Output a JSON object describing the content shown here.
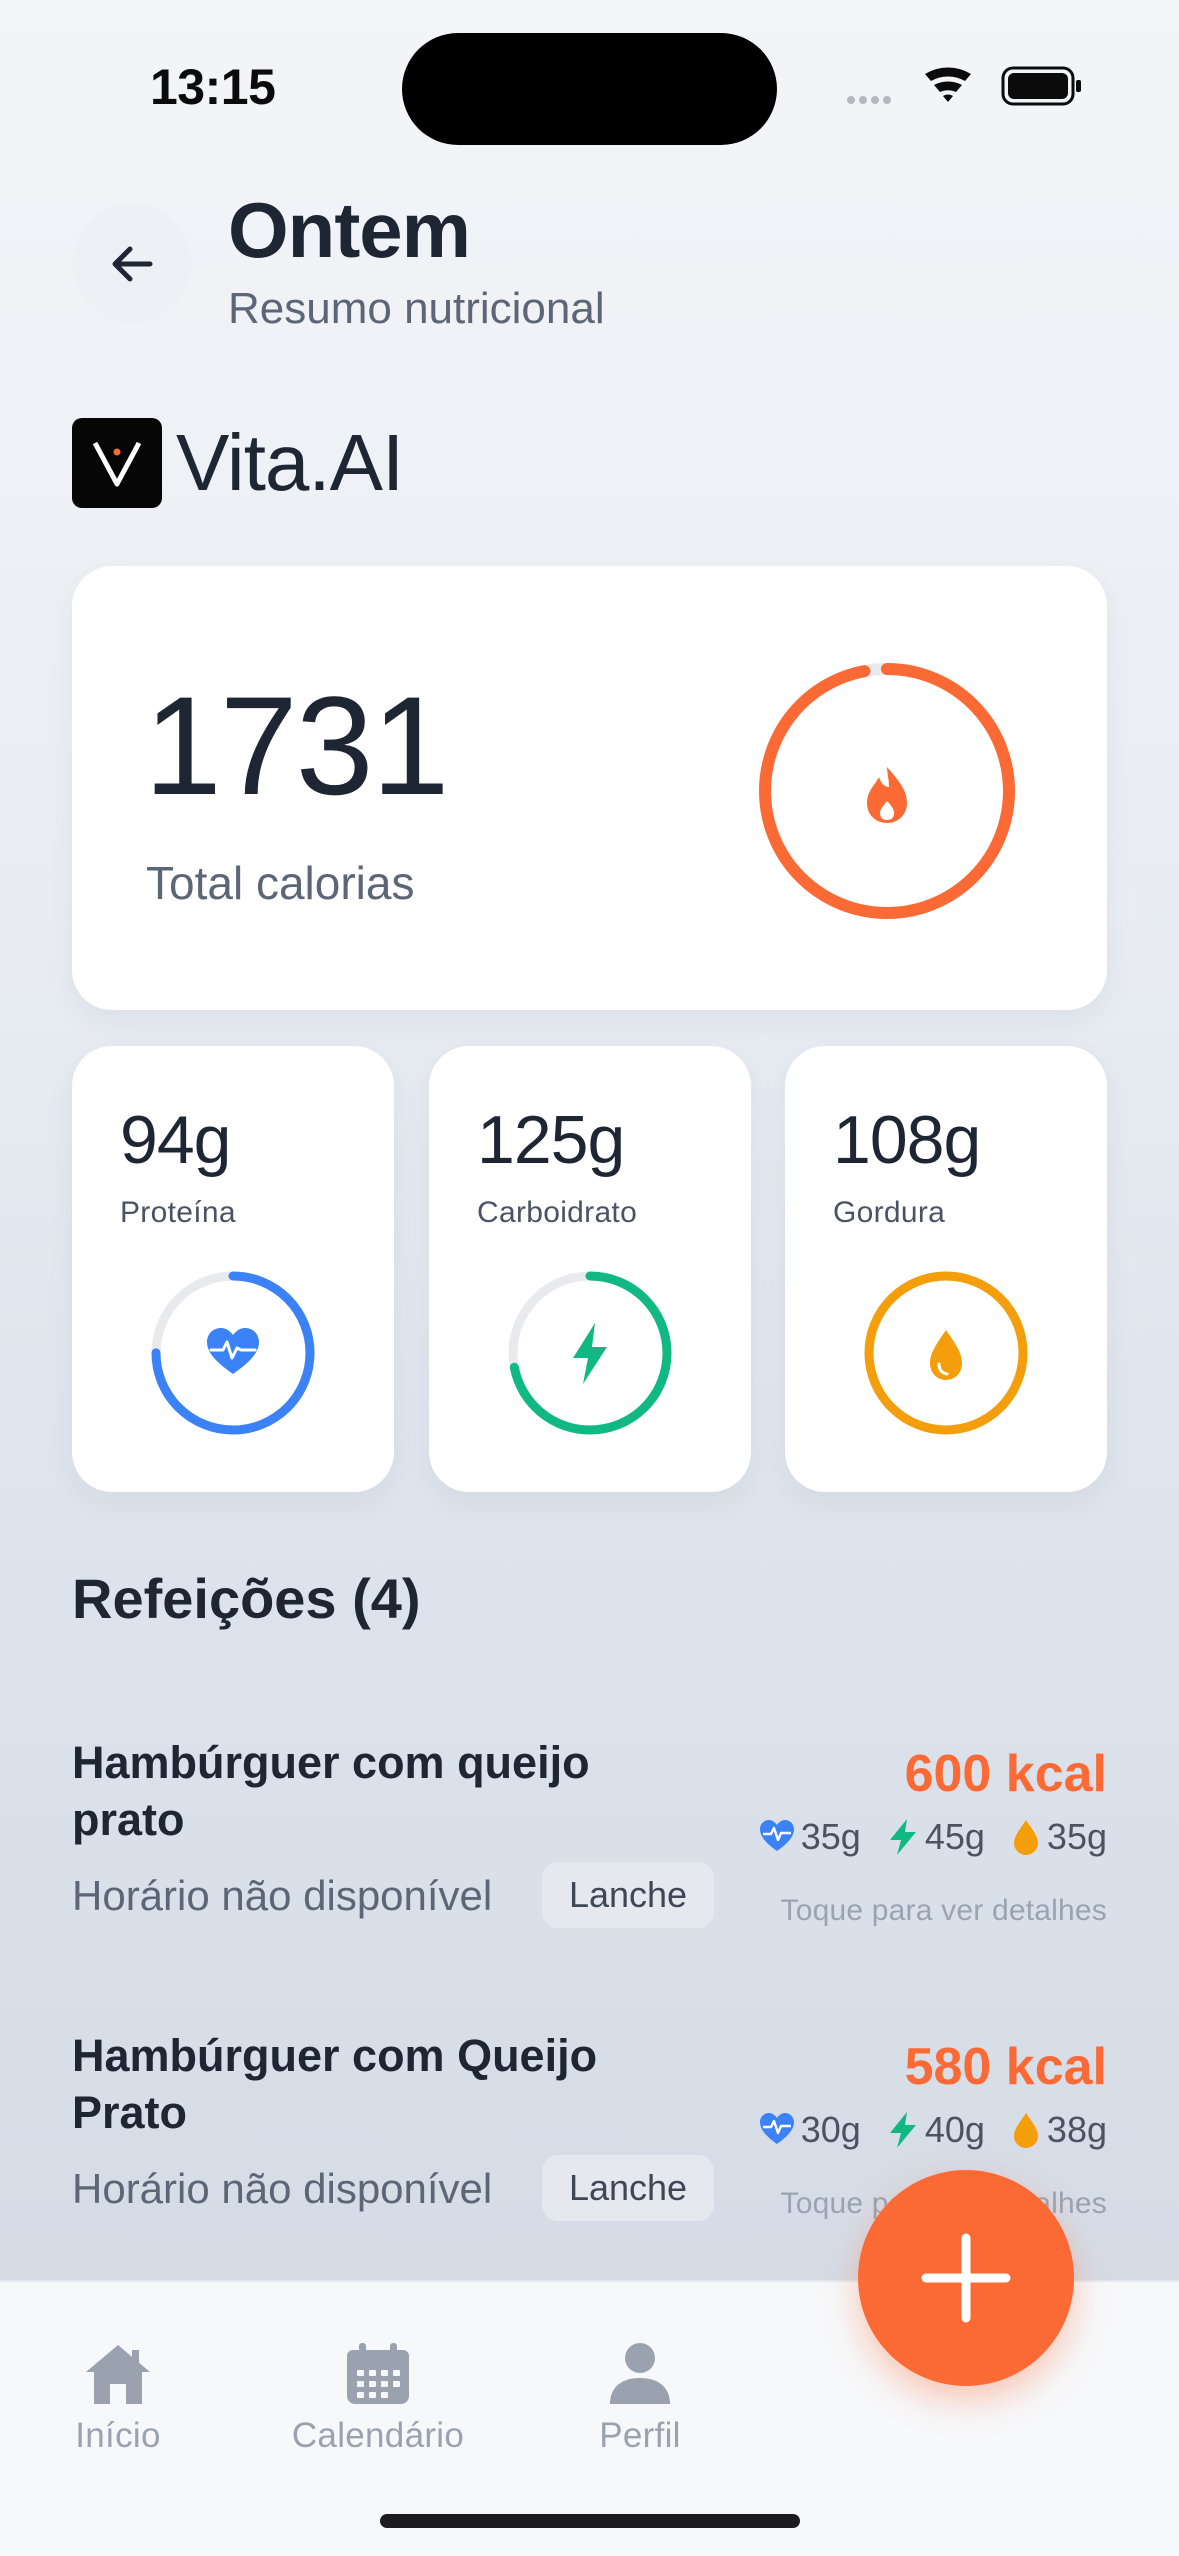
{
  "status_bar": {
    "time": "13:15"
  },
  "header": {
    "title": "Ontem",
    "subtitle": "Resumo nutricional"
  },
  "brand": {
    "name": "Vita.AI"
  },
  "calories": {
    "value": "1731",
    "label": "Total calorias",
    "ring_progress": 0.97,
    "color": "#FB6A35"
  },
  "macros": [
    {
      "value": "94g",
      "label": "Proteína",
      "icon": "heart-pulse-icon",
      "color": "#3B82F6",
      "ring_progress": 0.75
    },
    {
      "value": "125g",
      "label": "Carboidrato",
      "icon": "lightning-icon",
      "color": "#10B981",
      "ring_progress": 0.72
    },
    {
      "value": "108g",
      "label": "Gordura",
      "icon": "drop-icon",
      "color": "#F59E0B",
      "ring_progress": 1.0
    }
  ],
  "meals_section": {
    "title": "Refeições (4)"
  },
  "meals": [
    {
      "name": "Hambúrguer com queijo prato",
      "time": "Horário não disponível",
      "tag": "Lanche",
      "kcal": "600 kcal",
      "protein": "35g",
      "carbs": "45g",
      "fat": "35g",
      "hint": "Toque para ver detalhes"
    },
    {
      "name": "Hambúrguer com Queijo Prato",
      "time": "Horário não disponível",
      "tag": "Lanche",
      "kcal": "580 kcal",
      "protein": "30g",
      "carbs": "40g",
      "fat": "38g",
      "hint": "Toque para ver detalhes"
    }
  ],
  "nav": {
    "items": [
      {
        "label": "Início",
        "icon": "home-icon"
      },
      {
        "label": "Calendário",
        "icon": "calendar-icon"
      },
      {
        "label": "Perfil",
        "icon": "person-icon"
      }
    ]
  },
  "fab": {
    "icon": "plus-icon",
    "color": "#FB6A35"
  }
}
